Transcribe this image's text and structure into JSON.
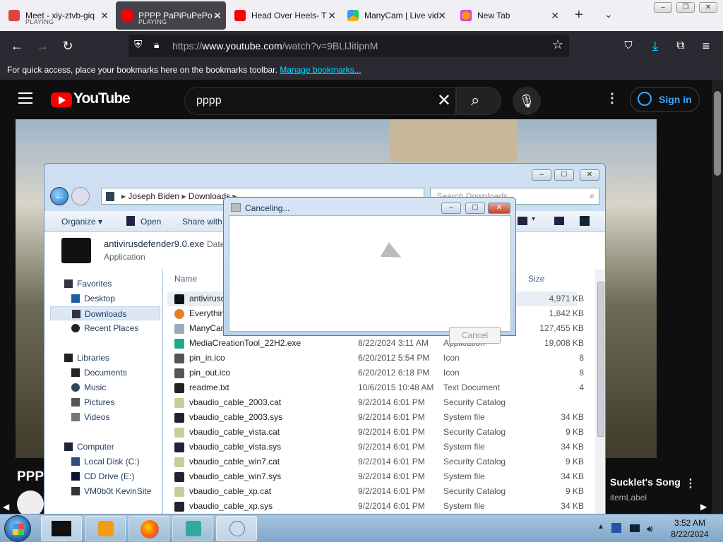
{
  "browser": {
    "tabs": [
      {
        "title": "Meet - xiy-ztvb-giq",
        "sub": "PLAYING"
      },
      {
        "title": "PPPP PaPiPuPePo -",
        "sub": "PLAYING"
      },
      {
        "title": "Head Over Heels- T"
      },
      {
        "title": "ManyCam | Live vid"
      },
      {
        "title": "New Tab"
      }
    ],
    "url_prefix": "https://",
    "url_host": "www.youtube.com",
    "url_path": "/watch?v=9BLlJitipnM",
    "bookmarks_msg": "For quick access, place your bookmarks here on the bookmarks toolbar.",
    "bookmarks_link": "Manage bookmarks..."
  },
  "youtube": {
    "logo_text": "YouTube",
    "search_value": "pppp",
    "signin_label": "Sign in",
    "video_title_partial": "PPP",
    "side_title": "Sucklet's Song",
    "side_sub": "itemLabel"
  },
  "explorer": {
    "breadcrumb": [
      "Joseph Biden",
      "Downloads"
    ],
    "search_placeholder": "Search Downloads",
    "cmd": {
      "organize": "Organize",
      "open": "Open",
      "share": "Share with"
    },
    "selected_name": "antivirusdefender9.0.exe",
    "selected_date_label": "Date",
    "selected_type": "Application",
    "nav": {
      "favorites": "Favorites",
      "desktop": "Desktop",
      "downloads": "Downloads",
      "recent": "Recent Places",
      "libraries": "Libraries",
      "documents": "Documents",
      "music": "Music",
      "pictures": "Pictures",
      "videos": "Videos",
      "computer": "Computer",
      "local_disk": "Local Disk (C:)",
      "cd_drive": "CD Drive (E:)",
      "vm": "VM0b0t KevinSite"
    },
    "columns": {
      "name": "Name",
      "size": "Size"
    },
    "files": [
      {
        "name": "antivirusc",
        "date": "",
        "type": "",
        "size": "4,971 KB"
      },
      {
        "name": "Everythin",
        "date": "",
        "type": "",
        "size": "1,842 KB"
      },
      {
        "name": "ManyCar",
        "date": "",
        "type": "",
        "size": "127,455 KB"
      },
      {
        "name": "MediaCreationTool_22H2.exe",
        "date": "8/22/2024 3:11 AM",
        "type": "Application",
        "size": "19,008 KB"
      },
      {
        "name": "pin_in.ico",
        "date": "6/20/2012 5:54 PM",
        "type": "Icon",
        "size": "8"
      },
      {
        "name": "pin_out.ico",
        "date": "6/20/2012 6:18 PM",
        "type": "Icon",
        "size": "8"
      },
      {
        "name": "readme.txt",
        "date": "10/6/2015 10:48 AM",
        "type": "Text Document",
        "size": "4"
      },
      {
        "name": "vbaudio_cable_2003.cat",
        "date": "9/2/2014 6:01 PM",
        "type": "Security Catalog",
        "size": ""
      },
      {
        "name": "vbaudio_cable_2003.sys",
        "date": "9/2/2014 6:01 PM",
        "type": "System file",
        "size": "34 KB"
      },
      {
        "name": "vbaudio_cable_vista.cat",
        "date": "9/2/2014 6:01 PM",
        "type": "Security Catalog",
        "size": "9 KB"
      },
      {
        "name": "vbaudio_cable_vista.sys",
        "date": "9/2/2014 6:01 PM",
        "type": "System file",
        "size": "34 KB"
      },
      {
        "name": "vbaudio_cable_win7.cat",
        "date": "9/2/2014 6:01 PM",
        "type": "Security Catalog",
        "size": "9 KB"
      },
      {
        "name": "vbaudio_cable_win7.sys",
        "date": "9/2/2014 6:01 PM",
        "type": "System file",
        "size": "34 KB"
      },
      {
        "name": "vbaudio_cable_xp.cat",
        "date": "9/2/2014 6:01 PM",
        "type": "Security Catalog",
        "size": "9 KB"
      },
      {
        "name": "vbaudio_cable_xp.sys",
        "date": "9/2/2014 6:01 PM",
        "type": "System file",
        "size": "34 KB"
      }
    ]
  },
  "dialog": {
    "title": "Canceling...",
    "cancel_label": "Cancel"
  },
  "taskbar": {
    "time": "3:52 AM",
    "date": "8/22/2024"
  },
  "colors": {
    "youtube_red": "#ff0000",
    "firefox_dark": "#2b2a33",
    "link_cyan": "#00ddff",
    "signin_blue": "#3ea6ff"
  }
}
